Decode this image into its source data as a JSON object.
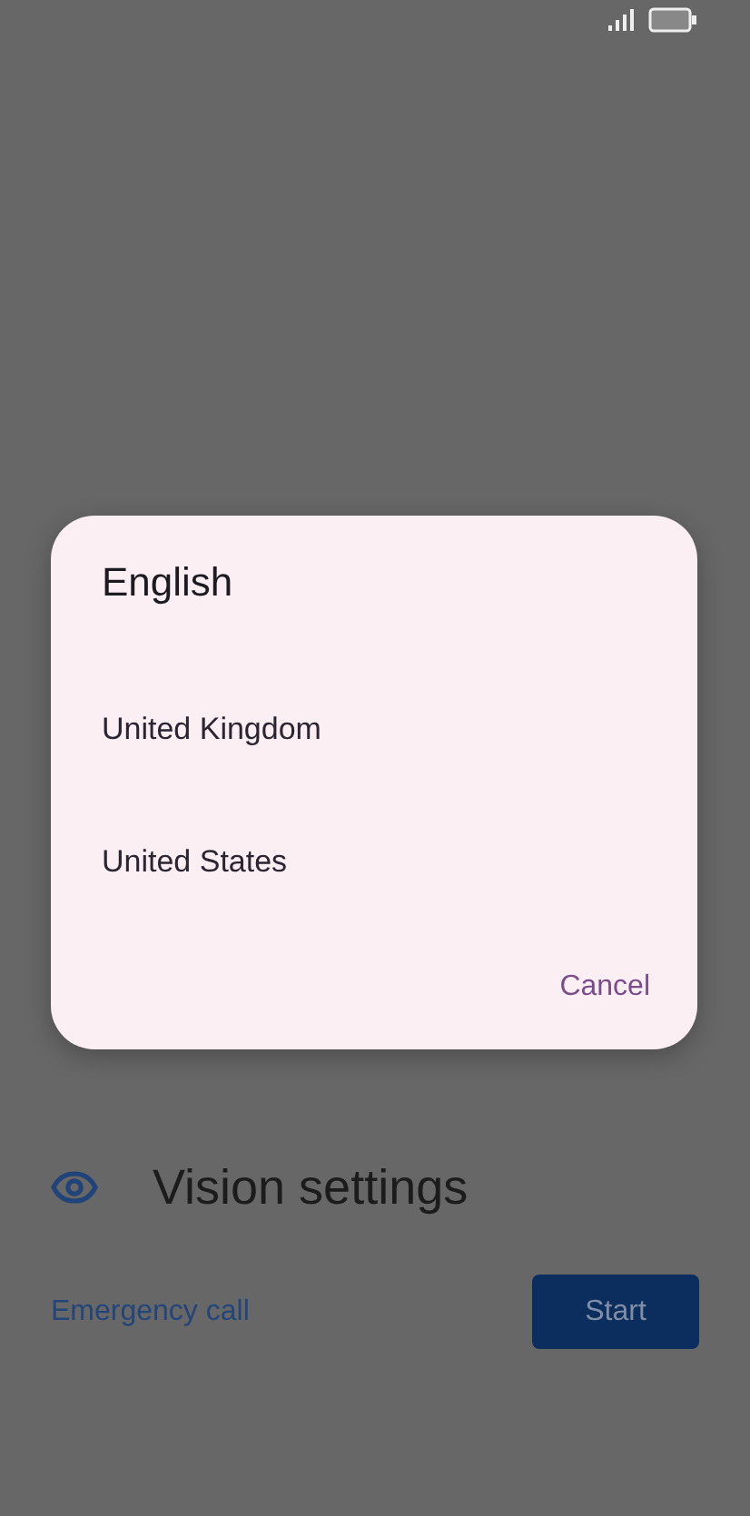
{
  "dialog": {
    "title": "English",
    "options": [
      {
        "label": "United Kingdom"
      },
      {
        "label": "United States"
      }
    ],
    "cancel": "Cancel"
  },
  "vision_settings": {
    "label": "Vision settings"
  },
  "footer": {
    "emergency_call": "Emergency call",
    "start": "Start"
  }
}
